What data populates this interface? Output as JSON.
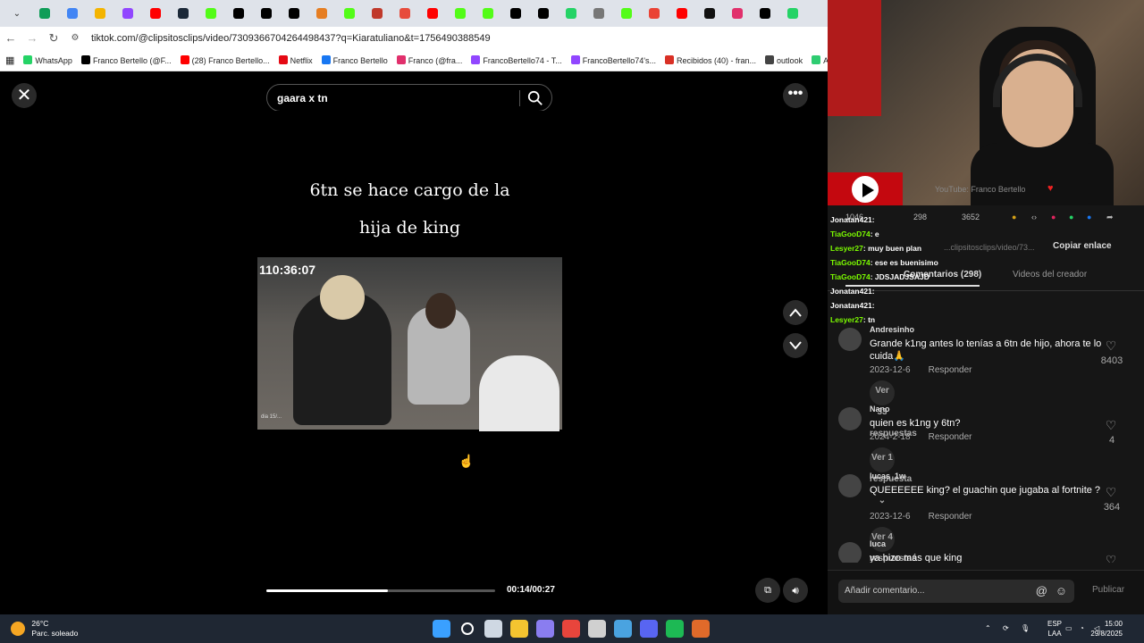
{
  "browser": {
    "tabs": [
      "sheets",
      "docs",
      "drive",
      "twitch",
      "youtube",
      "steam",
      "kick",
      "twitter",
      "x",
      "x",
      "game",
      "kick",
      "flashscore",
      "ubersuggest",
      "youtube",
      "kick",
      "kick",
      "x",
      "x",
      "whatsapp",
      "wiki",
      "kick",
      "maps",
      "youtube",
      "tiktok",
      "instagram",
      "x",
      "whatsapp"
    ],
    "url": "tiktok.com/@clipsitosclips/video/7309366704264498437?q=Kiaratuliano&t=1756490388549",
    "bookmarks": [
      {
        "label": "WhatsApp",
        "color": "#25d366"
      },
      {
        "label": "Franco Bertello (@F...",
        "color": "#000000"
      },
      {
        "label": "(28) Franco Bertello...",
        "color": "#ff0000"
      },
      {
        "label": "Netflix",
        "color": "#e50914"
      },
      {
        "label": "Franco Bertello",
        "color": "#1877f2"
      },
      {
        "label": "Franco (@fra...",
        "color": "#e1306c"
      },
      {
        "label": "FrancoBertello74 - T...",
        "color": "#9146ff"
      },
      {
        "label": "FrancoBertello74's...",
        "color": "#9146ff"
      },
      {
        "label": "Recibidos (40) - fran...",
        "color": "#d93025"
      },
      {
        "label": "outlook",
        "color": "#444444"
      },
      {
        "label": "Aler",
        "color": "#2ecc71"
      }
    ]
  },
  "player": {
    "search_value": "gaara x tn",
    "title_line1": "6tn se hace cargo de la",
    "title_line2": "hija de king",
    "timestamp_overlay": "110:36:07",
    "time": "00:14/00:27",
    "progress": 0.53,
    "frame_caption": "dia 15/..."
  },
  "stream": {
    "yt_label": "YouTube: Franco Bertello",
    "chat": [
      {
        "user": "Jonatan421",
        "msg": ":"
      },
      {
        "user": "TiaGooD74",
        "msg": ": e"
      },
      {
        "user": "Lesyer27",
        "msg": ": muy buen plan"
      },
      {
        "user": "TiaGooD74",
        "msg": ": ese es buenisimo"
      },
      {
        "user": "TiaGooD74",
        "msg": ": JDSJADJSAJD"
      },
      {
        "user": "Jonatan421",
        "msg": ":"
      },
      {
        "user": "Jonatan421",
        "msg": ":"
      },
      {
        "user": "Lesyer27",
        "msg": ": tn"
      }
    ]
  },
  "panel": {
    "stats": {
      "likes": "1046",
      "comments": "298",
      "saves": "3652"
    },
    "link_text": "...clipsitosclips/video/73...",
    "copy_link": "Copiar enlace",
    "tab_comments": "Comentarios (298)",
    "tab_creator": "Videos del creador",
    "comments": [
      {
        "user": "Andresinho",
        "text": "Grande k1ng antes lo tenías a 6tn de hijo, ahora te lo cuida🙏",
        "date": "2023-12-6",
        "reply": "Responder",
        "likes": "8403",
        "more": "Ver 33 respuestas ⌄"
      },
      {
        "user": "Nano",
        "text": "quien es k1ng y 6tn?",
        "date": "2024-2-18",
        "reply": "Responder",
        "likes": "4",
        "more": "Ver 1 respuesta ⌄"
      },
      {
        "user": "lucas_1w",
        "text": "QUEEEEEE king? el guachin que jugaba al fortnite ?",
        "date": "2023-12-6",
        "reply": "Responder",
        "likes": "364",
        "more": "Ver 4 respuestas ⌄"
      },
      {
        "user": "luca",
        "text": "ya hizo más que king",
        "date": "",
        "reply": "",
        "likes": "",
        "more": ""
      }
    ],
    "input_placeholder": "Añadir comentario...",
    "publish": "Publicar"
  },
  "taskbar": {
    "temp": "26°C",
    "weather": "Parc. soleado",
    "badge": "6",
    "lang1": "ESP",
    "lang2": "LAA",
    "time": "15:00",
    "date": "29/8/2025",
    "icons": [
      "start-icon",
      "search-icon",
      "taskview-icon",
      "explorer-icon",
      "app-icon",
      "chrome-icon",
      "app2-icon",
      "steam-icon",
      "discord-icon",
      "spotify-icon",
      "app3-icon"
    ],
    "icon_colors": [
      "#3aa0ff",
      "#ffffff",
      "#cfd8e3",
      "#f4c430",
      "#8a7df0",
      "#e8453c",
      "#d0d0d0",
      "#4aa3e0",
      "#5865f2",
      "#1db954",
      "#e06a2a"
    ]
  }
}
